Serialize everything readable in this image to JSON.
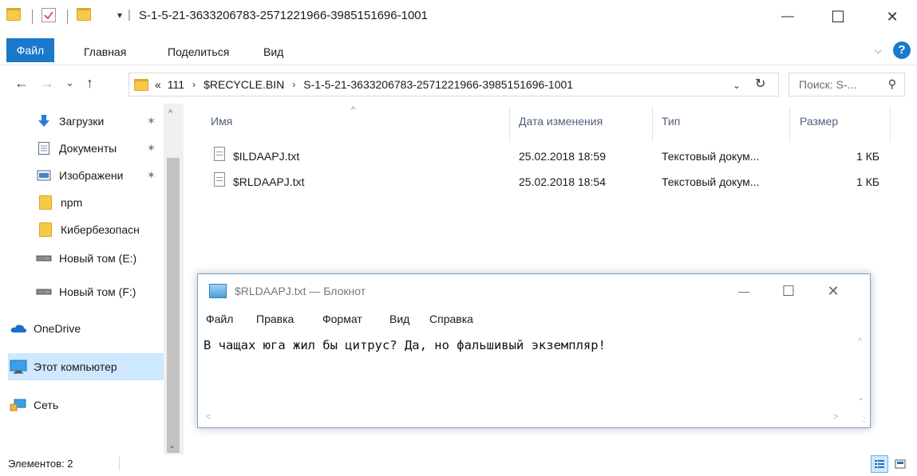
{
  "window": {
    "title": "S-1-5-21-3633206783-2571221966-3985151696-1001",
    "qa_separator": "|",
    "qa_dropdown": "▾",
    "minimize_glyph": "—",
    "maximize_glyph": "☐",
    "close_glyph": "✕"
  },
  "ribbon": {
    "tabs": [
      "Файл",
      "Главная",
      "Поделиться",
      "Вид"
    ],
    "collapse_glyph": "⌵",
    "help_glyph": "?"
  },
  "navigation": {
    "back_glyph": "←",
    "forward_glyph": "→",
    "recent_glyph": "⌄",
    "up_glyph": "↑",
    "breadcrumb_prefix": "«",
    "crumb_separator": "›",
    "breadcrumbs": [
      "111",
      "$RECYCLE.BIN",
      "S-1-5-21-3633206783-2571221966-3985151696-1001"
    ],
    "dropdown_glyph": "⌄",
    "refresh_glyph": "↻",
    "search_placeholder": "Поиск: S-...",
    "search_glyph": "⚲"
  },
  "sidebar": {
    "items": [
      {
        "label": "Загрузки",
        "icon": "download-icon",
        "pinned": true
      },
      {
        "label": "Документы",
        "icon": "documents-icon",
        "pinned": true
      },
      {
        "label": "Изображени",
        "icon": "pictures-icon",
        "pinned": true
      },
      {
        "label": "npm",
        "icon": "folder-icon",
        "pinned": false
      },
      {
        "label": "Кибербезопасн",
        "icon": "folder-icon",
        "pinned": false
      },
      {
        "label": "Новый том (E:)",
        "icon": "drive-icon",
        "pinned": false
      },
      {
        "label": "Новый том (F:)",
        "icon": "drive-icon",
        "pinned": false
      },
      {
        "label": "OneDrive",
        "icon": "onedrive-icon",
        "pinned": false
      },
      {
        "label": "Этот компьютер",
        "icon": "computer-icon",
        "pinned": false,
        "selected": true
      },
      {
        "label": "Сеть",
        "icon": "network-icon",
        "pinned": false
      }
    ],
    "pin_glyph": "✶",
    "scroll_up_glyph": "^",
    "scroll_down_glyph": "⌄"
  },
  "file_list": {
    "columns": [
      "Имя",
      "Дата изменения",
      "Тип",
      "Размер"
    ],
    "sort_glyph": "^",
    "rows": [
      {
        "name": "$ILDAAPJ.txt",
        "modified": "25.02.2018 18:59",
        "type": "Текстовый докум...",
        "size": "1 КБ"
      },
      {
        "name": "$RLDAAPJ.txt",
        "modified": "25.02.2018 18:54",
        "type": "Текстовый докум...",
        "size": "1 КБ"
      }
    ]
  },
  "status_bar": {
    "items_count": "Элементов: 2"
  },
  "notepad": {
    "title": "$RLDAAPJ.txt — Блокнот",
    "menu": [
      "Файл",
      "Правка",
      "Формат",
      "Вид",
      "Справка"
    ],
    "content": "В чащах юга жил бы цитрус? Да, но фальшивый экземпляр!",
    "minimize_glyph": "—",
    "maximize_glyph": "☐",
    "close_glyph": "✕",
    "scroll_up_glyph": "^",
    "scroll_down_glyph": "⌄",
    "scroll_left_glyph": "<",
    "scroll_right_glyph": ">",
    "grip_glyph": ".:"
  },
  "colors": {
    "accent": "#1979ca",
    "selection": "#cde8ff",
    "header_text": "#4c607a",
    "folder": "#f7c948"
  }
}
